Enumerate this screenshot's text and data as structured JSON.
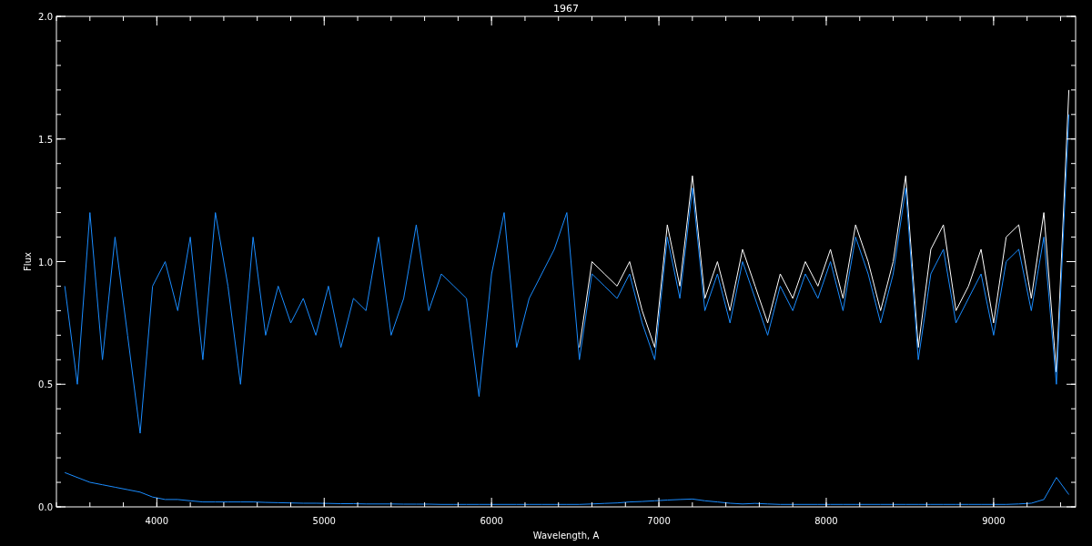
{
  "plot": {
    "chart_data": {
      "type": "line",
      "title": "1967",
      "xlabel": "Wavelength, A",
      "ylabel": "Flux",
      "xlim": [
        3400,
        9490
      ],
      "ylim": [
        0,
        2
      ],
      "xticks": [
        4000,
        5000,
        6000,
        7000,
        8000,
        9000
      ],
      "yticks": [
        {
          "value": 0,
          "label": "0.0"
        },
        {
          "value": 0.5,
          "label": "0.5"
        },
        {
          "value": 1,
          "label": "1.0"
        },
        {
          "value": 1.5,
          "label": "1.5"
        },
        {
          "value": 2,
          "label": "2.0"
        }
      ],
      "x": [
        3450,
        3525,
        3600,
        3675,
        3750,
        3825,
        3900,
        3975,
        4050,
        4125,
        4200,
        4275,
        4350,
        4425,
        4500,
        4575,
        4650,
        4725,
        4800,
        4875,
        4950,
        5025,
        5100,
        5175,
        5250,
        5325,
        5400,
        5475,
        5550,
        5625,
        5700,
        5775,
        5850,
        5925,
        6000,
        6075,
        6150,
        6225,
        6300,
        6375,
        6450,
        6525,
        6600,
        6675,
        6750,
        6825,
        6900,
        6975,
        7050,
        7125,
        7200,
        7275,
        7350,
        7425,
        7500,
        7575,
        7650,
        7725,
        7800,
        7875,
        7950,
        8025,
        8100,
        8175,
        8250,
        8325,
        8400,
        8475,
        8550,
        8625,
        8700,
        8775,
        8850,
        8925,
        9000,
        9075,
        9150,
        9225,
        9300,
        9375,
        9450
      ],
      "series": [
        {
          "color": "#ffffff",
          "values": [
            null,
            null,
            null,
            null,
            null,
            null,
            null,
            null,
            null,
            null,
            null,
            null,
            null,
            null,
            null,
            null,
            null,
            null,
            null,
            null,
            null,
            null,
            null,
            null,
            null,
            null,
            null,
            null,
            null,
            null,
            null,
            null,
            null,
            null,
            null,
            null,
            null,
            null,
            null,
            null,
            null,
            0.65,
            1.0,
            0.95,
            0.9,
            1.0,
            0.8,
            0.65,
            1.15,
            0.9,
            1.35,
            0.85,
            1.0,
            0.8,
            1.05,
            0.9,
            0.75,
            0.95,
            0.85,
            1.0,
            0.9,
            1.05,
            0.85,
            1.15,
            1.0,
            0.8,
            1.0,
            1.35,
            0.65,
            1.05,
            1.15,
            0.8,
            0.9,
            1.05,
            0.75,
            1.1,
            1.15,
            0.85,
            1.2,
            0.55,
            1.7
          ]
        },
        {
          "color": "#1a8cff",
          "values": [
            0.9,
            0.5,
            1.2,
            0.6,
            1.1,
            0.7,
            0.3,
            0.9,
            1.0,
            0.8,
            1.1,
            0.6,
            1.2,
            0.9,
            0.5,
            1.1,
            0.7,
            0.9,
            0.75,
            0.85,
            0.7,
            0.9,
            0.65,
            0.85,
            0.8,
            1.1,
            0.7,
            0.85,
            1.15,
            0.8,
            0.95,
            0.9,
            0.85,
            0.45,
            0.95,
            1.2,
            0.65,
            0.85,
            0.95,
            1.05,
            1.2,
            0.6,
            0.95,
            0.9,
            0.85,
            0.95,
            0.75,
            0.6,
            1.1,
            0.85,
            1.3,
            0.8,
            0.95,
            0.75,
            1.0,
            0.85,
            0.7,
            0.9,
            0.8,
            0.95,
            0.85,
            1.0,
            0.8,
            1.1,
            0.95,
            0.75,
            0.95,
            1.3,
            0.6,
            0.95,
            1.05,
            0.75,
            0.85,
            0.95,
            0.7,
            1.0,
            1.05,
            0.8,
            1.1,
            0.5,
            1.6
          ]
        },
        {
          "color": "#1a8cff",
          "values": [
            0.14,
            0.12,
            0.1,
            0.09,
            0.08,
            0.07,
            0.06,
            0.04,
            0.03,
            0.03,
            0.025,
            0.02,
            0.02,
            0.02,
            0.02,
            0.02,
            0.018,
            0.017,
            0.016,
            0.015,
            0.015,
            0.014,
            0.013,
            0.013,
            0.012,
            0.012,
            0.012,
            0.011,
            0.011,
            0.011,
            0.01,
            0.01,
            0.01,
            0.01,
            0.01,
            0.01,
            0.01,
            0.01,
            0.01,
            0.01,
            0.01,
            0.01,
            0.012,
            0.014,
            0.016,
            0.02,
            0.022,
            0.025,
            0.028,
            0.03,
            0.032,
            0.025,
            0.02,
            0.015,
            0.012,
            0.014,
            0.012,
            0.01,
            0.01,
            0.01,
            0.01,
            0.01,
            0.01,
            0.01,
            0.01,
            0.01,
            0.01,
            0.01,
            0.01,
            0.01,
            0.01,
            0.01,
            0.01,
            0.01,
            0.01,
            0.01,
            0.012,
            0.015,
            0.03,
            0.12,
            0.05
          ]
        }
      ]
    }
  }
}
